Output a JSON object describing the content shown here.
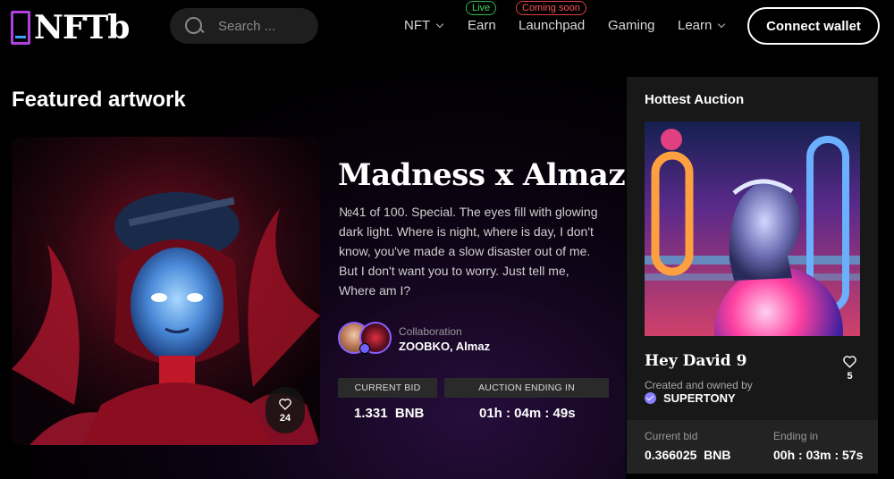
{
  "header": {
    "logo_text": "NFTb",
    "search_placeholder": "Search ...",
    "nav": {
      "nft": "NFT",
      "earn": "Earn",
      "earn_badge": "Live",
      "launchpad": "Launchpad",
      "launchpad_badge": "Coming soon",
      "gaming": "Gaming",
      "learn": "Learn"
    },
    "connect_label": "Connect wallet"
  },
  "featured": {
    "heading": "Featured artwork",
    "artwork_likes": "24",
    "title": "Madness x Almaz",
    "description": "№41 of 100. Special. The eyes fill with glowing dark light. Where is night, where is day, I don't know, you've made a slow disaster out of me. But I don't want you to worry. Just tell me, Where am I?",
    "collab_label": "Collaboration",
    "collab_names": "ZOOBKO, Almaz",
    "current_bid_label": "CURRENT BID",
    "current_bid_value": "1.331  BNB",
    "auction_end_label": "AUCTION ENDING IN",
    "auction_end_value": "01h : 04m : 49s"
  },
  "auction": {
    "heading": "Hottest Auction",
    "name": "Hey David 9",
    "created_label": "Created and owned by",
    "owner": "SUPERTONY",
    "likes": "5",
    "current_bid_label": "Current bid",
    "current_bid_value": "0.366025  BNB",
    "ending_label": "Ending in",
    "ending_value": "00h : 03m : 57s"
  },
  "colors": {
    "badge_live": "#38d85a",
    "badge_soon": "#ff5050",
    "panel_bg": "#181818",
    "verified": "#8a80ff"
  }
}
